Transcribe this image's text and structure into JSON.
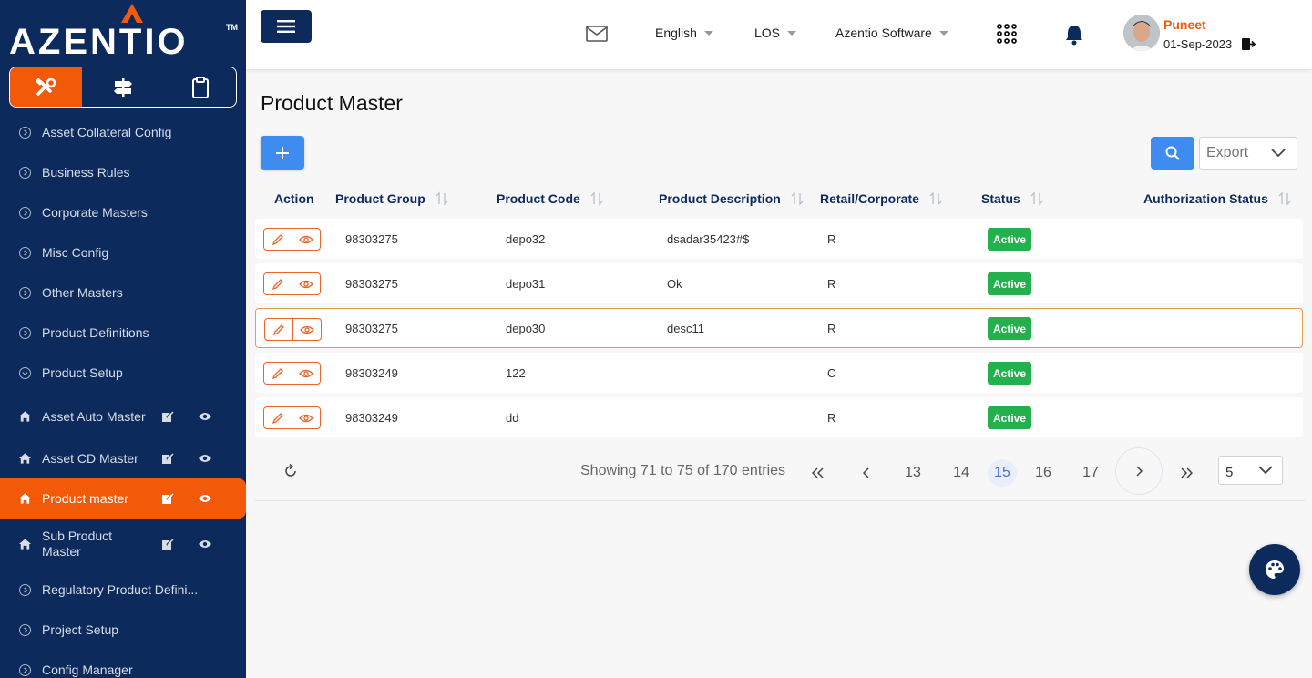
{
  "brand": {
    "name": "AZENTIO",
    "tm": "TM"
  },
  "sidebar": {
    "tabs": [
      {
        "icon": "tools-icon",
        "active": true
      },
      {
        "icon": "signpost-icon",
        "active": false
      },
      {
        "icon": "clipboard-icon",
        "active": false
      }
    ],
    "menu_top": [
      {
        "label": "Asset Collateral Config"
      },
      {
        "label": "Business Rules"
      },
      {
        "label": "Corporate Masters"
      },
      {
        "label": "Misc Config"
      },
      {
        "label": "Other Masters"
      },
      {
        "label": "Product Definitions"
      },
      {
        "label": "Product Setup"
      }
    ],
    "sub_items": [
      {
        "label": "Asset Auto Master",
        "active": false
      },
      {
        "label": "Asset CD Master",
        "active": false
      },
      {
        "label": "Product master",
        "active": true
      },
      {
        "label": "Sub Product Master",
        "active": false
      }
    ],
    "menu_bottom": [
      {
        "label": "Regulatory Product Defini..."
      },
      {
        "label": "Project Setup"
      },
      {
        "label": "Config Manager"
      }
    ]
  },
  "header": {
    "language": "English",
    "module": "LOS",
    "company": "Azentio Software",
    "user": {
      "name": "Puneet",
      "date": "01-Sep-2023"
    }
  },
  "page": {
    "title": "Product Master",
    "export_label": "Export"
  },
  "table": {
    "columns": [
      "Action",
      "Product Group",
      "Product Code",
      "Product Description",
      "Retail/Corporate",
      "Status",
      "Authorization Status"
    ],
    "rows": [
      {
        "group": "98303275",
        "code": "depo32",
        "desc": "dsadar35423#$",
        "rc": "R",
        "status": "Active",
        "auth": "",
        "selected": false
      },
      {
        "group": "98303275",
        "code": "depo31",
        "desc": "Ok",
        "rc": "R",
        "status": "Active",
        "auth": "",
        "selected": false
      },
      {
        "group": "98303275",
        "code": "depo30",
        "desc": "desc11",
        "rc": "R",
        "status": "Active",
        "auth": "",
        "selected": true
      },
      {
        "group": "98303249",
        "code": "122",
        "desc": "",
        "rc": "C",
        "status": "Active",
        "auth": "",
        "selected": false
      },
      {
        "group": "98303249",
        "code": "dd",
        "desc": "",
        "rc": "R",
        "status": "Active",
        "auth": "",
        "selected": false
      }
    ]
  },
  "pagination": {
    "summary": "Showing 71 to 75 of 170 entries",
    "pages": [
      "13",
      "14",
      "15",
      "16",
      "17"
    ],
    "current": "15",
    "page_size": "5"
  },
  "colors": {
    "navy": "#0d2a5c",
    "accent": "#f25a0a",
    "primary": "#3f8cf0",
    "success": "#22b14c"
  }
}
